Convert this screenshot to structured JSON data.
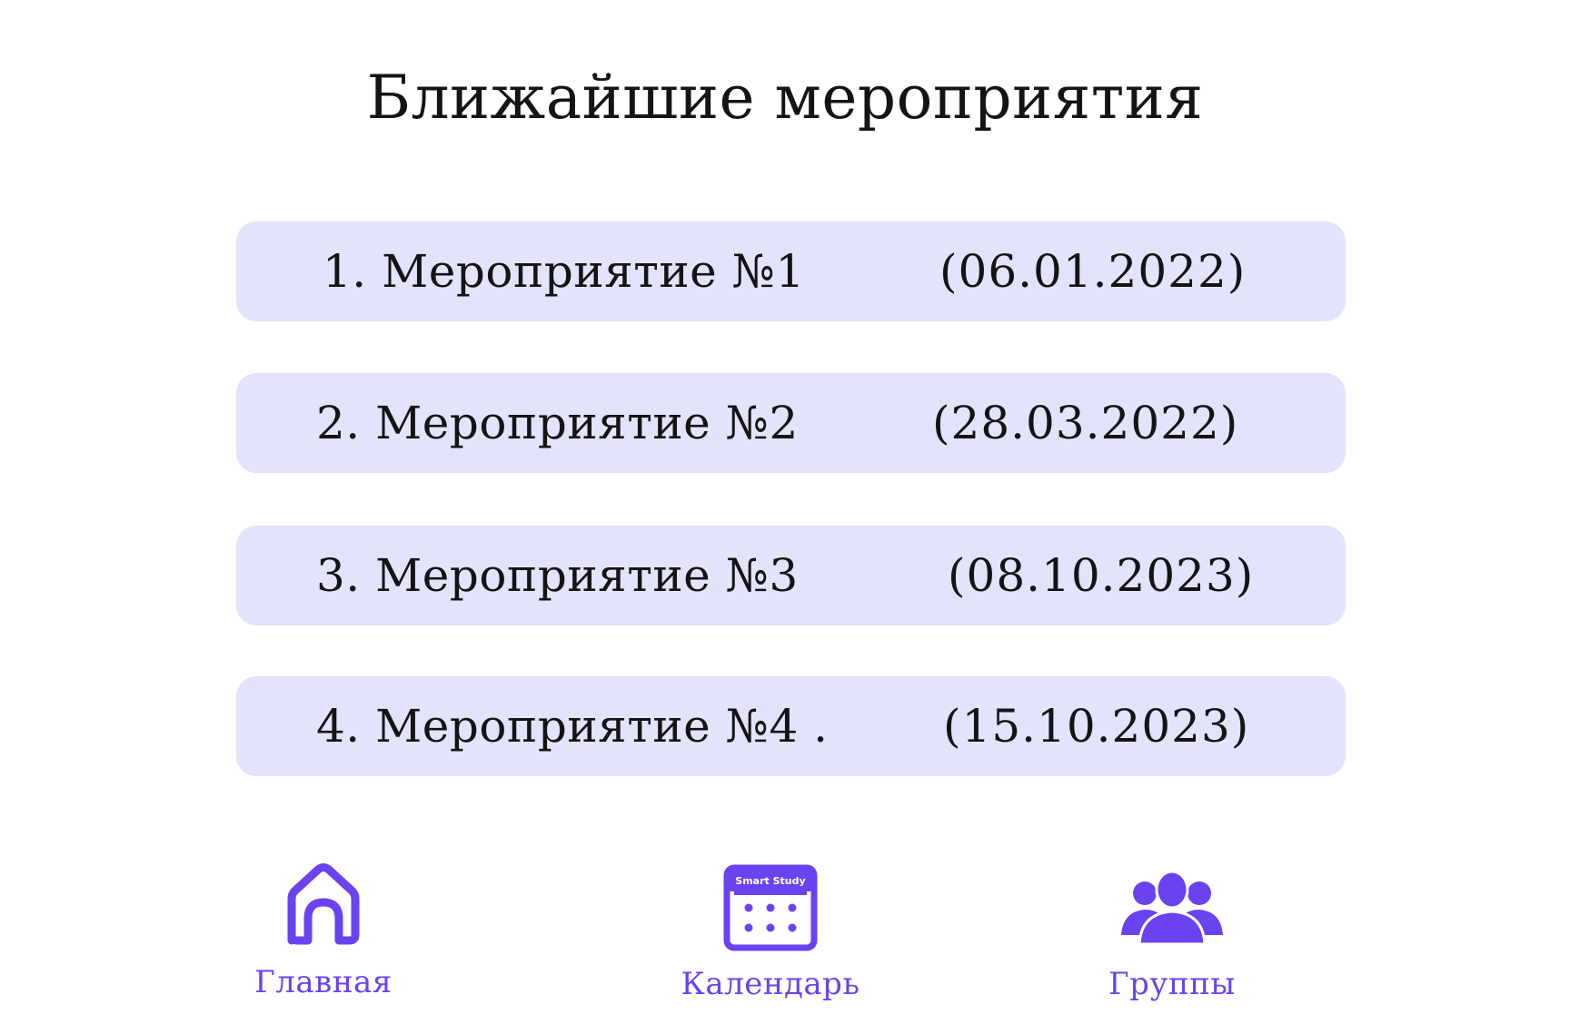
{
  "header": {
    "title": "Ближайшие мероприятия"
  },
  "events": [
    {
      "name": "1. Мероприятие №1",
      "date": "(06.01.2022)"
    },
    {
      "name": "2. Мероприятие №2",
      "date": "(28.03.2022)"
    },
    {
      "name": "3. Мероприятие №3",
      "date": "(08.10.2023)"
    },
    {
      "name": "4. Мероприятие №4 .",
      "date": "(15.10.2023)"
    }
  ],
  "nav": {
    "home_label": "Главная",
    "calendar_label": "Календарь",
    "calendar_icon_text": "Smart Study",
    "groups_label": "Группы"
  },
  "colors": {
    "accent": "#6b42f0",
    "card_background": "#e3e3fc"
  },
  "icons": {
    "home": "house-icon",
    "calendar": "calendar-icon",
    "groups": "people-group-icon"
  }
}
